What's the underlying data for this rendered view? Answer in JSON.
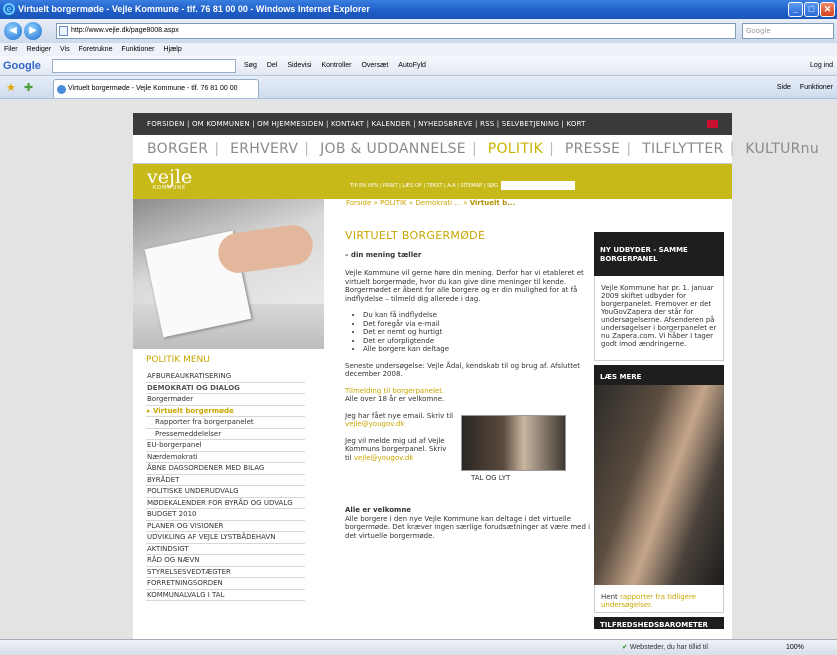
{
  "window": {
    "title": "Virtuelt borgermøde - Vejle Kommune - tlf. 76 81 00 00 - Windows Internet Explorer",
    "url": "http://www.vejle.dk/page8008.aspx",
    "search_placeholder": "Google"
  },
  "menubar": [
    "Filer",
    "Rediger",
    "Vis",
    "Foretrukne",
    "Funktioner",
    "Hjælp"
  ],
  "googlebar": {
    "logo": "Google",
    "items": [
      "Søg",
      "Del",
      "Sidevisi",
      "Kontroller",
      "Oversæt",
      "AutoFyld"
    ],
    "login": "Log ind"
  },
  "tab": {
    "label": "Virtuelt borgermøde - Vejle Kommune - tlf. 76 81 00 00",
    "tools": [
      "Side",
      "Funktioner"
    ]
  },
  "site": {
    "topnav": "FORSIDEN  |  OM KOMMUNEN  |  OM HJEMMESIDEN  |  KONTAKT  |  KALENDER  |  NYHEDSBREVE  |  RSS  |  SELVBETJENING  |  KORT",
    "mainnav": [
      "BORGER",
      "ERHVERV",
      "JOB & UDDANNELSE",
      "POLITIK",
      "PRESSE",
      "TILFLYTTER",
      "KULTURnu"
    ],
    "logo": "vejle",
    "logo_sub": "KOMMUNE",
    "tools": "TIP EN VEN  |  PRINT  |  LÆS OP  |  TEKST  |  A-A  |  SITEMAP  |  SØG",
    "breadcrumb": [
      "Forside",
      "POLITIK",
      "Demokrati ...",
      "Virtuelt b..."
    ]
  },
  "menu": {
    "title": "POLITIK MENU",
    "items": [
      "AFBUREAUKRATISERING",
      "DEMOKRATI OG DIALOG",
      "Borgermøder",
      "Virtuelt borgermøde",
      "Rapporter fra borgerpanelet",
      "Pressemeddelelser",
      "EU-borgerpanel",
      "Nærdemokrati",
      "ÅBNE DAGSORDENER MED BILAG",
      "BYRÅDET",
      "POLITISKE UNDERUDVALG",
      "MØDEKALENDER FOR BYRÅD OG UDVALG",
      "BUDGET 2010",
      "PLANER OG VISIONER",
      "UDVIKLING AF VEJLE LYSTBÅDEHAVN",
      "AKTINDSIGT",
      "RÅD OG NÆVN",
      "STYRELSESVEDTÆGTER",
      "FORRETNINGSORDEN",
      "KOMMUNALVALG I TAL"
    ]
  },
  "content": {
    "title": "VIRTUELT BORGERMØDE",
    "subtitle": "– din mening tæller",
    "intro": "Vejle Kommune vil gerne høre din mening. Derfor har vi etableret et virtuelt borgermøde, hvor du kan give dine meninger til kende. Borgermødet er åbent for alle borgere og er din mulighed for at få indflydelse – tilmeld dig allerede i dag.",
    "bullets": [
      "Du kan få indflydelse",
      "Det foregår via e-mail",
      "Det er nemt og hurtigt",
      "Det er uforpligtende",
      "Alle borgere kan deltage"
    ],
    "survey": "Seneste undersøgelse: Vejle Ådal, kendskab til og brug af. Afsluttet december 2008.",
    "signup_link": "Tilmelding til borgerpanelet.",
    "signup_text": "Alle over 18 år er velkomne.",
    "new_email_text": "Jeg har fået nye email.  Skriv til",
    "email": "vejle@yougov.dk",
    "leave_text": "Jeg vil melde mig ud af Vejle Kommuns borgerpanel. Skriv til",
    "photo_caption": "TAL OG LYT",
    "welcome_title": "Alle er velkomne",
    "welcome_text": "Alle borgere i den nye Vejle Kommune kan deltage i det virtuelle borgermøde. Det kræver ingen særlige forudsætninger at være med i det virtuelle borgermøde."
  },
  "sidebar": {
    "box1_title": "NY UDBYDER - SAMME BORGERPANEL",
    "box1_text": "Vejle Kommune har pr. 1. januar 2009 skiftet udbyder for borgerpanelet. Fremover er det YouGovZapera der står for undersøgelserne. Afsenderen på undersøgelser i borgerpanelet er nu Zapera.com. Vi håber I tager godt imod ændringerne.",
    "box2_title": "LÆS MERE",
    "box2_text_pre": "Hent ",
    "box2_link": "rapporter fra tidligere undersøgelser.",
    "box3_title": "TILFREDSHEDSBAROMETER"
  },
  "status": {
    "zone": "Websteder, du har tillid til",
    "zoom": "100%"
  }
}
